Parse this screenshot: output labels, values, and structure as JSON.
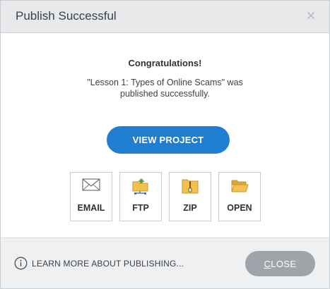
{
  "window": {
    "title": "Publish Successful"
  },
  "body": {
    "heading": "Congratulations!",
    "message": "\"Lesson 1: Types of Online Scams\" was published successfully.",
    "view_project_label": "VIEW PROJECT"
  },
  "tiles": [
    {
      "label": "EMAIL",
      "icon": "envelope-icon"
    },
    {
      "label": "FTP",
      "icon": "ftp-folder-icon"
    },
    {
      "label": "ZIP",
      "icon": "zip-folder-icon"
    },
    {
      "label": "OPEN",
      "icon": "open-folder-icon"
    }
  ],
  "footer": {
    "learn_more_label": "LEARN MORE ABOUT PUBLISHING...",
    "close_first_letter": "C",
    "close_rest": "LOSE"
  },
  "colors": {
    "accent": "#1f7ed0",
    "close_button": "#9ea4aa",
    "folder": "#f2c14e",
    "ftp_arrow": "#5aa832"
  }
}
